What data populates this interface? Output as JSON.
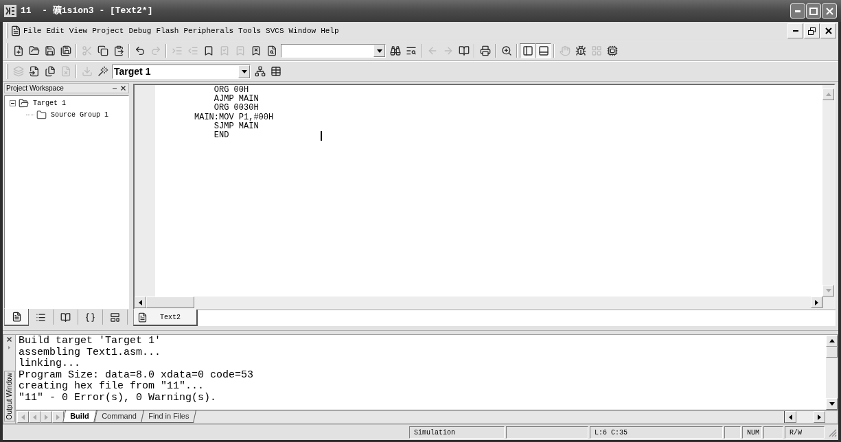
{
  "window": {
    "title": "11  - 礦ision3 - [Text2*]"
  },
  "menu": {
    "items": [
      "File",
      "Edit",
      "View",
      "Project",
      "Debug",
      "Flash",
      "Peripherals",
      "Tools",
      "SVCS",
      "Window",
      "Help"
    ]
  },
  "toolbars": [
    {
      "buttons": [
        {
          "disabled": false,
          "pressed": false
        },
        {
          "disabled": false,
          "pressed": false
        },
        {
          "disabled": false,
          "pressed": false
        },
        {
          "disabled": false,
          "pressed": false
        },
        {
          "disabled": true,
          "pressed": false
        },
        {
          "disabled": false,
          "pressed": false
        },
        {
          "disabled": false,
          "pressed": false
        },
        {
          "disabled": false,
          "pressed": false
        },
        {
          "disabled": true,
          "pressed": false
        },
        {
          "disabled": true,
          "pressed": false
        },
        {
          "disabled": true,
          "pressed": false
        },
        {
          "disabled": false,
          "pressed": false
        },
        {
          "disabled": true,
          "pressed": false
        },
        {
          "disabled": true,
          "pressed": false
        },
        {
          "disabled": false,
          "pressed": false
        },
        {
          "disabled": false,
          "pressed": false
        },
        {
          "disabled": false,
          "pressed": false
        },
        {
          "disabled": false,
          "pressed": false
        },
        {
          "disabled": true,
          "pressed": false
        },
        {
          "disabled": true,
          "pressed": false
        },
        {
          "disabled": false,
          "pressed": false
        },
        {
          "disabled": false,
          "pressed": false
        },
        {
          "disabled": false,
          "pressed": false
        },
        {
          "disabled": false,
          "pressed": true
        },
        {
          "disabled": false,
          "pressed": true
        },
        {
          "disabled": true,
          "pressed": false
        },
        {
          "disabled": false,
          "pressed": false
        },
        {
          "disabled": true,
          "pressed": false
        },
        {
          "disabled": false,
          "pressed": false
        }
      ]
    },
    {
      "buttons": [
        {
          "disabled": true,
          "pressed": false
        },
        {
          "disabled": false,
          "pressed": false
        },
        {
          "disabled": false,
          "pressed": false
        },
        {
          "disabled": true,
          "pressed": false
        },
        {
          "disabled": true,
          "pressed": false
        },
        {
          "disabled": false,
          "pressed": false
        },
        {
          "disabled": false,
          "pressed": false
        },
        {
          "disabled": false,
          "pressed": false
        }
      ],
      "target_select": {
        "value": "Target 1"
      }
    }
  ],
  "project_workspace": {
    "title": "Project Workspace",
    "tree": [
      {
        "label": "Target 1",
        "expanded": true,
        "children": [
          {
            "label": "Source Group 1"
          }
        ]
      }
    ],
    "tabs": [
      {
        "selected": true
      },
      {
        "selected": false
      },
      {
        "selected": false
      },
      {
        "selected": false
      },
      {
        "selected": false
      }
    ]
  },
  "editor": {
    "lines": [
      "\tORG 00H",
      "\tAJMP MAIN",
      "\tORG 0030H",
      "MAIN:MOV P1,#00H",
      "\tSJMP MAIN",
      "\tEND"
    ],
    "tabs": [
      {
        "label": "Text2",
        "selected": true
      }
    ]
  },
  "output_window": {
    "title": "Output Window",
    "lines": [
      "Build target 'Target 1'",
      "assembling Text1.asm...",
      "linking...",
      "Program Size: data=8.0 xdata=0 code=53",
      "creating hex file from \"11\"...",
      "\"11\" - 0 Error(s), 0 Warning(s)."
    ],
    "tabs": [
      {
        "label": "Build",
        "selected": true
      },
      {
        "label": "Command",
        "selected": false
      },
      {
        "label": "Find in Files",
        "selected": false
      }
    ]
  },
  "status_bar": {
    "panels": [
      "Simulation",
      "L:6 C:35",
      "NUM",
      "R/W"
    ]
  }
}
